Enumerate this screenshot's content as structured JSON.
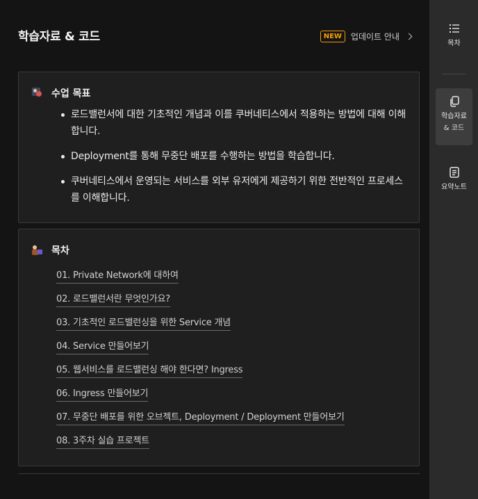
{
  "header": {
    "title": "학습자료 & 코드",
    "new_badge": "NEW",
    "update_label": "업데이트 안내"
  },
  "goals": {
    "title": "수업 목표",
    "items": [
      "로드밸런서에 대한 기초적인 개념과 이를 쿠버네티스에서 적용하는 방법에 대해 이해합니다.",
      "Deployment를 통해 무중단 배포를 수행하는 방법을 학습합니다.",
      "쿠버네티스에서 운영되는 서비스를 외부 유저에게 제공하기 위한 전반적인 프로세스를 이해합니다."
    ]
  },
  "toc": {
    "title": "목차",
    "items": [
      "01. Private Network에 대하여",
      "02. 로드밸런서란 무엇인가요?",
      "03. 기초적인 로드밸런싱을 위한 Service 개념",
      "04. Service 만들어보기",
      "05. 웹서비스를 로드밸런싱 해야 한다면? Ingress",
      "06. Ingress 만들어보기",
      "07. 무중단 배포를 위한 오브젝트, Deployment / Deployment 만들어보기",
      "08. 3주차 실습 프로젝트"
    ]
  },
  "sidebar": {
    "items": [
      {
        "label": "목차",
        "icon": "list-icon"
      },
      {
        "label": "학습자료 & 코드",
        "icon": "copy-icon"
      },
      {
        "label": "요약노트",
        "icon": "note-icon"
      }
    ]
  },
  "colors": {
    "accent_new": "#f59e0b",
    "background": "#141414",
    "card": "#1f1f1f",
    "sidebar": "#2b2b2b"
  }
}
